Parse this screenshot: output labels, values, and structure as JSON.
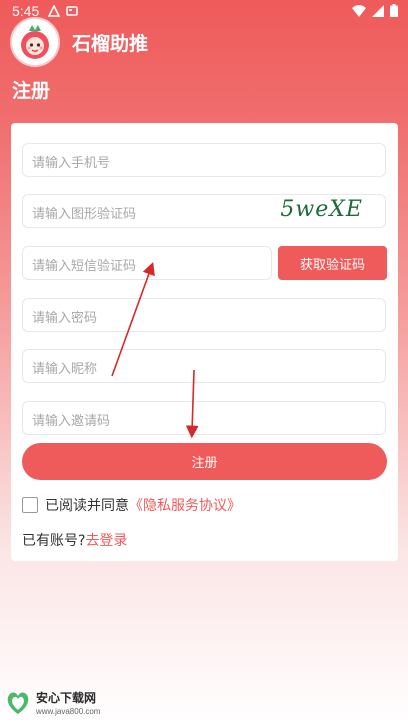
{
  "status_bar": {
    "time": "5:45"
  },
  "app": {
    "title": "石榴助推"
  },
  "page": {
    "title": "注册"
  },
  "form": {
    "phone_placeholder": "请输入手机号",
    "image_code_placeholder": "请输入图形验证码",
    "captcha_text": "5weXE",
    "sms_code_placeholder": "请输入短信验证码",
    "sms_button": "获取验证码",
    "password_placeholder": "请输入密码",
    "nickname_placeholder": "请输入昵称",
    "invite_placeholder": "请输入邀请码",
    "register_button": "注册",
    "agree_prefix": "已阅读并同意",
    "agree_link": "《隐私服务协议》",
    "has_account": "已有账号?",
    "login_link": "去登录"
  },
  "watermark": {
    "name": "安心下载网",
    "url": "www.java800.com"
  },
  "colors": {
    "accent": "#ef5a5a",
    "captcha": "#1d6b3a"
  }
}
